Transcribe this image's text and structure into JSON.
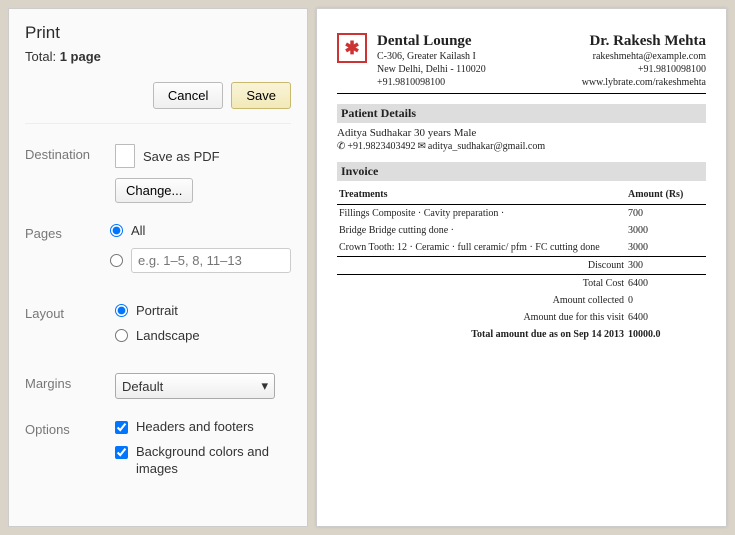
{
  "print": {
    "title": "Print",
    "total_prefix": "Total: ",
    "total_value": "1 page",
    "cancel": "Cancel",
    "save": "Save",
    "destination_label": "Destination",
    "destination_value": "Save as PDF",
    "change_btn": "Change...",
    "pages_label": "Pages",
    "pages_all": "All",
    "pages_placeholder": "e.g. 1–5, 8, 11–13",
    "layout_label": "Layout",
    "layout_portrait": "Portrait",
    "layout_landscape": "Landscape",
    "margins_label": "Margins",
    "margins_value": "Default",
    "options_label": "Options",
    "opt_headers": "Headers and footers",
    "opt_bg": "Background colors and images"
  },
  "invoice": {
    "clinic": {
      "name": "Dental Lounge",
      "addr1": "C-306, Greater Kailash I",
      "addr2": "New Delhi, Delhi - 110020",
      "phone": "+91.9810098100"
    },
    "doctor": {
      "name": "Dr. Rakesh Mehta",
      "email": "rakeshmehta@example.com",
      "phone": "+91.9810098100",
      "web": "www.lybrate.com/rakeshmehta"
    },
    "patient_section": "Patient Details",
    "patient": {
      "name_age": "Aditya Sudhakar 30 years Male",
      "phone": "+91.9823403492",
      "email": "aditya_sudhakar@gmail.com"
    },
    "invoice_section": "Invoice",
    "th_treatments": "Treatments",
    "th_amount": "Amount (Rs)",
    "items": [
      {
        "desc": "Fillings Composite · Cavity preparation ·",
        "amt": "700"
      },
      {
        "desc": "Bridge Bridge cutting done ·",
        "amt": "3000"
      },
      {
        "desc": "Crown Tooth: 12 · Ceramic · full ceramic/ pfm · FC cutting done",
        "amt": "3000"
      }
    ],
    "summary": {
      "discount_label": "Discount",
      "discount_val": "300",
      "total_label": "Total Cost",
      "total_val": "6400",
      "collected_label": "Amount collected",
      "collected_val": "0",
      "due_visit_label": "Amount due for this visit",
      "due_visit_val": "6400",
      "due_total_label": "Total amount due as on Sep 14 2013",
      "due_total_val": "10000.0"
    }
  }
}
